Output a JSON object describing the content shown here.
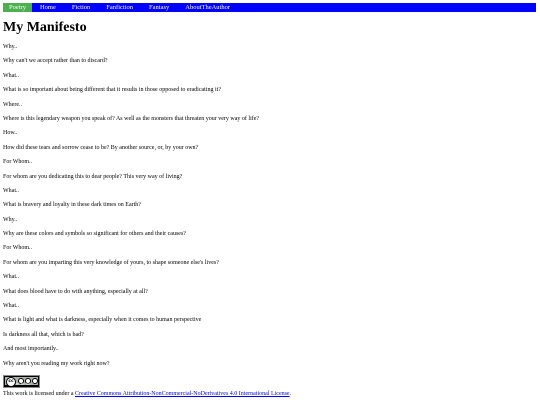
{
  "nav": {
    "items": [
      {
        "label": "Poetry",
        "active": true
      },
      {
        "label": "Home",
        "active": false
      },
      {
        "label": "Fiction",
        "active": false
      },
      {
        "label": "Fanfiction",
        "active": false
      },
      {
        "label": "Fantasy",
        "active": false
      },
      {
        "label": "AboutTheAuthor",
        "active": false
      }
    ],
    "bar_color": "#0000ff",
    "active_color": "#4caf50"
  },
  "page": {
    "title": "My Manifesto"
  },
  "poem": {
    "lines": [
      "Why..",
      "Why can't we accept rather than to discard?",
      "What..",
      "What is so important about being different that it results in those opposed to eradicating it?",
      "Where..",
      "Where is this legendary weapon you speak of? As well as the monsters that threaten your very way of life?",
      "How..",
      "How did these tears and sorrow cease to be? By another source, or, by your own?",
      "For Whom..",
      "For whom are you dedicating this to dear people? This very way of living?",
      "What..",
      "What is bravery and loyalty in these dark times on Earth?",
      "Why..",
      "Why are these colors and symbols so significant for others and their causes?",
      "For Whom..",
      "For whom are you imparting this very knowledge of yours, to shape someone else's lives?",
      "What..",
      "What does blood have to do with anything, especially at all?",
      "What..",
      "What is light and what is darkness, especially when it comes to human perspective",
      "Is darkness all that, which is bad?",
      "And most importantly..",
      "Why aren't you reading my work right now?"
    ]
  },
  "license": {
    "badge_logo": "cc",
    "badge_icons": [
      "by-icon",
      "nc-icon",
      "nd-icon"
    ],
    "badge_caption": "BY NC ND",
    "prefix": "This work is licensed under a ",
    "link_text": "Creative Commons Attribution-NonCommercial-NoDerivatives 4.0 International License",
    "suffix": "."
  }
}
